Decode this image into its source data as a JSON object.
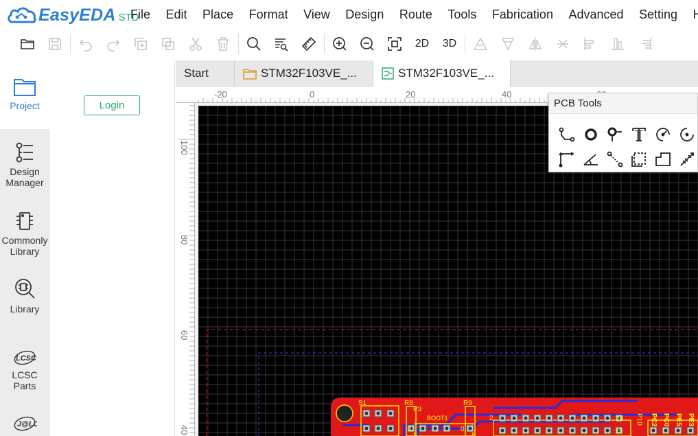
{
  "app": {
    "brand": "EasyEDA",
    "edition": "STD",
    "brand_color": "#2d7fd0",
    "accent_color": "#2ea96b"
  },
  "menu": [
    "File",
    "Edit",
    "Place",
    "Format",
    "View",
    "Design",
    "Route",
    "Tools",
    "Fabrication",
    "Advanced",
    "Setting",
    "He"
  ],
  "toolbar": {
    "view2d": "2D",
    "view3d": "3D",
    "icons": [
      "open-icon",
      "save-icon",
      "undo-icon",
      "redo-icon",
      "copy-icon",
      "paste-icon",
      "cut-icon",
      "delete-icon",
      "find-icon",
      "find-similar-icon",
      "measure-icon",
      "zoom-in-icon",
      "zoom-out-icon",
      "fit-icon"
    ]
  },
  "sidebar": {
    "items": [
      {
        "label": "Project",
        "icon": "folder-icon",
        "active": true
      },
      {
        "label": "Design Manager",
        "icon": "design-manager-icon"
      },
      {
        "label": "Commonly Library",
        "icon": "chip-icon"
      },
      {
        "label": "Library",
        "icon": "library-search-icon"
      },
      {
        "label": "LCSC Parts",
        "icon": "lcsc-logo-icon"
      },
      {
        "label": "",
        "icon": "jlc-logo-icon"
      }
    ]
  },
  "panel": {
    "login_label": "Login"
  },
  "tabs": [
    {
      "label": "Start"
    },
    {
      "label": "STM32F103VE_...",
      "icon": "project-folder-icon"
    },
    {
      "label": "STM32F103VE_...",
      "icon": "pcb-doc-icon",
      "active": true
    }
  ],
  "rulers": {
    "top": [
      "-20",
      "0",
      "20",
      "40",
      "60"
    ],
    "left": [
      "100",
      "80",
      "60",
      "40"
    ]
  },
  "pcb_tools": {
    "title": "PCB Tools",
    "tools": [
      "track-icon",
      "pad-icon",
      "via-icon",
      "text-icon",
      "arc-icon",
      "circle-arc-icon",
      "dimension-angle-icon",
      "protractor-icon",
      "connect-pad-icon",
      "rect-select-icon",
      "solid-region-icon",
      "measure-line-icon"
    ]
  },
  "board": {
    "silkscreen": [
      "S1",
      "P3",
      "R8",
      "R9",
      "BOOT1",
      "0",
      "1",
      "2",
      "20",
      "19",
      "P10",
      "PC2",
      "PC0",
      "PE5",
      "PE3"
    ],
    "colors": {
      "canvas": "#000000",
      "grid": "#4a4a4a",
      "board_red": "#e01818",
      "board_outline": "#d01010",
      "silk": "#ffff00",
      "copper_blue": "#2a2ad8"
    }
  }
}
